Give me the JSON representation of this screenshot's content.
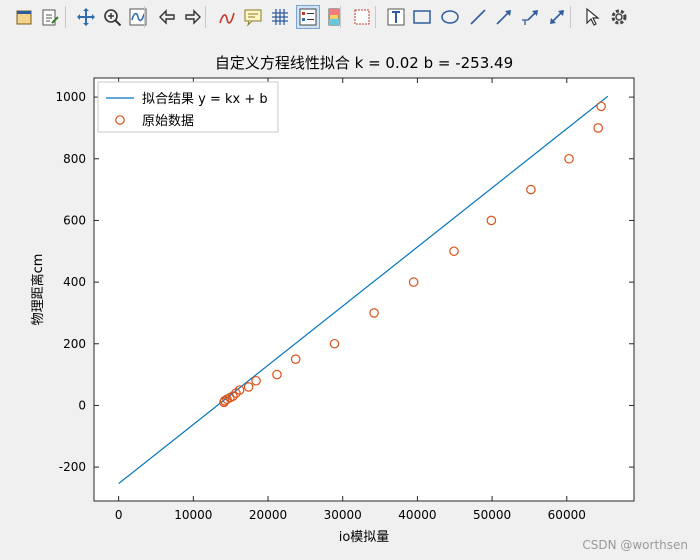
{
  "toolbar": {
    "buttons": [
      {
        "name": "open-file-icon"
      },
      {
        "name": "edit-file-icon"
      },
      {
        "name": "pan-icon"
      },
      {
        "name": "zoom-icon"
      },
      {
        "name": "rotate-icon"
      },
      {
        "name": "back-arrow-icon"
      },
      {
        "name": "forward-arrow-icon"
      },
      {
        "name": "brush-icon"
      },
      {
        "name": "comment-icon"
      },
      {
        "name": "grid-icon"
      },
      {
        "name": "legend-icon",
        "active": true
      },
      {
        "name": "colorbar-icon"
      },
      {
        "name": "subplot-icon"
      },
      {
        "name": "text-icon"
      },
      {
        "name": "rectangle-icon"
      },
      {
        "name": "ellipse-icon"
      },
      {
        "name": "line-icon"
      },
      {
        "name": "arrow-icon"
      },
      {
        "name": "text-arrow-icon"
      },
      {
        "name": "double-arrow-icon"
      },
      {
        "name": "pointer-icon"
      },
      {
        "name": "settings-icon"
      }
    ]
  },
  "chart_data": {
    "type": "line",
    "title": "自定义方程线性拟合 k = 0.02  b = -253.49",
    "xlabel": "io模拟量",
    "ylabel": "物理距离cm",
    "xlim": [
      -3300,
      69000
    ],
    "ylim": [
      -310,
      1062
    ],
    "xticks": [
      0,
      10000,
      20000,
      30000,
      40000,
      50000,
      60000
    ],
    "yticks": [
      -200,
      0,
      200,
      400,
      600,
      800,
      1000
    ],
    "grid": false,
    "legend_position": "top-left",
    "series": [
      {
        "name": "拟合结果 y = kx + b",
        "kind": "line",
        "color": "#0072bd",
        "x": [
          0,
          65500
        ],
        "y": [
          -253.49,
          1003
        ]
      },
      {
        "name": "原始数据",
        "kind": "marker",
        "color": "#d95319",
        "x": [
          14100,
          14200,
          14500,
          14900,
          15300,
          15700,
          16200,
          17400,
          18400,
          21200,
          23700,
          28900,
          34200,
          39500,
          44900,
          49900,
          55200,
          60300,
          64200,
          64600
        ],
        "y": [
          10,
          15,
          20,
          25,
          30,
          40,
          50,
          60,
          80,
          100,
          150,
          200,
          300,
          400,
          500,
          600,
          700,
          800,
          900,
          970
        ]
      }
    ]
  },
  "watermark": "CSDN @worthsen"
}
